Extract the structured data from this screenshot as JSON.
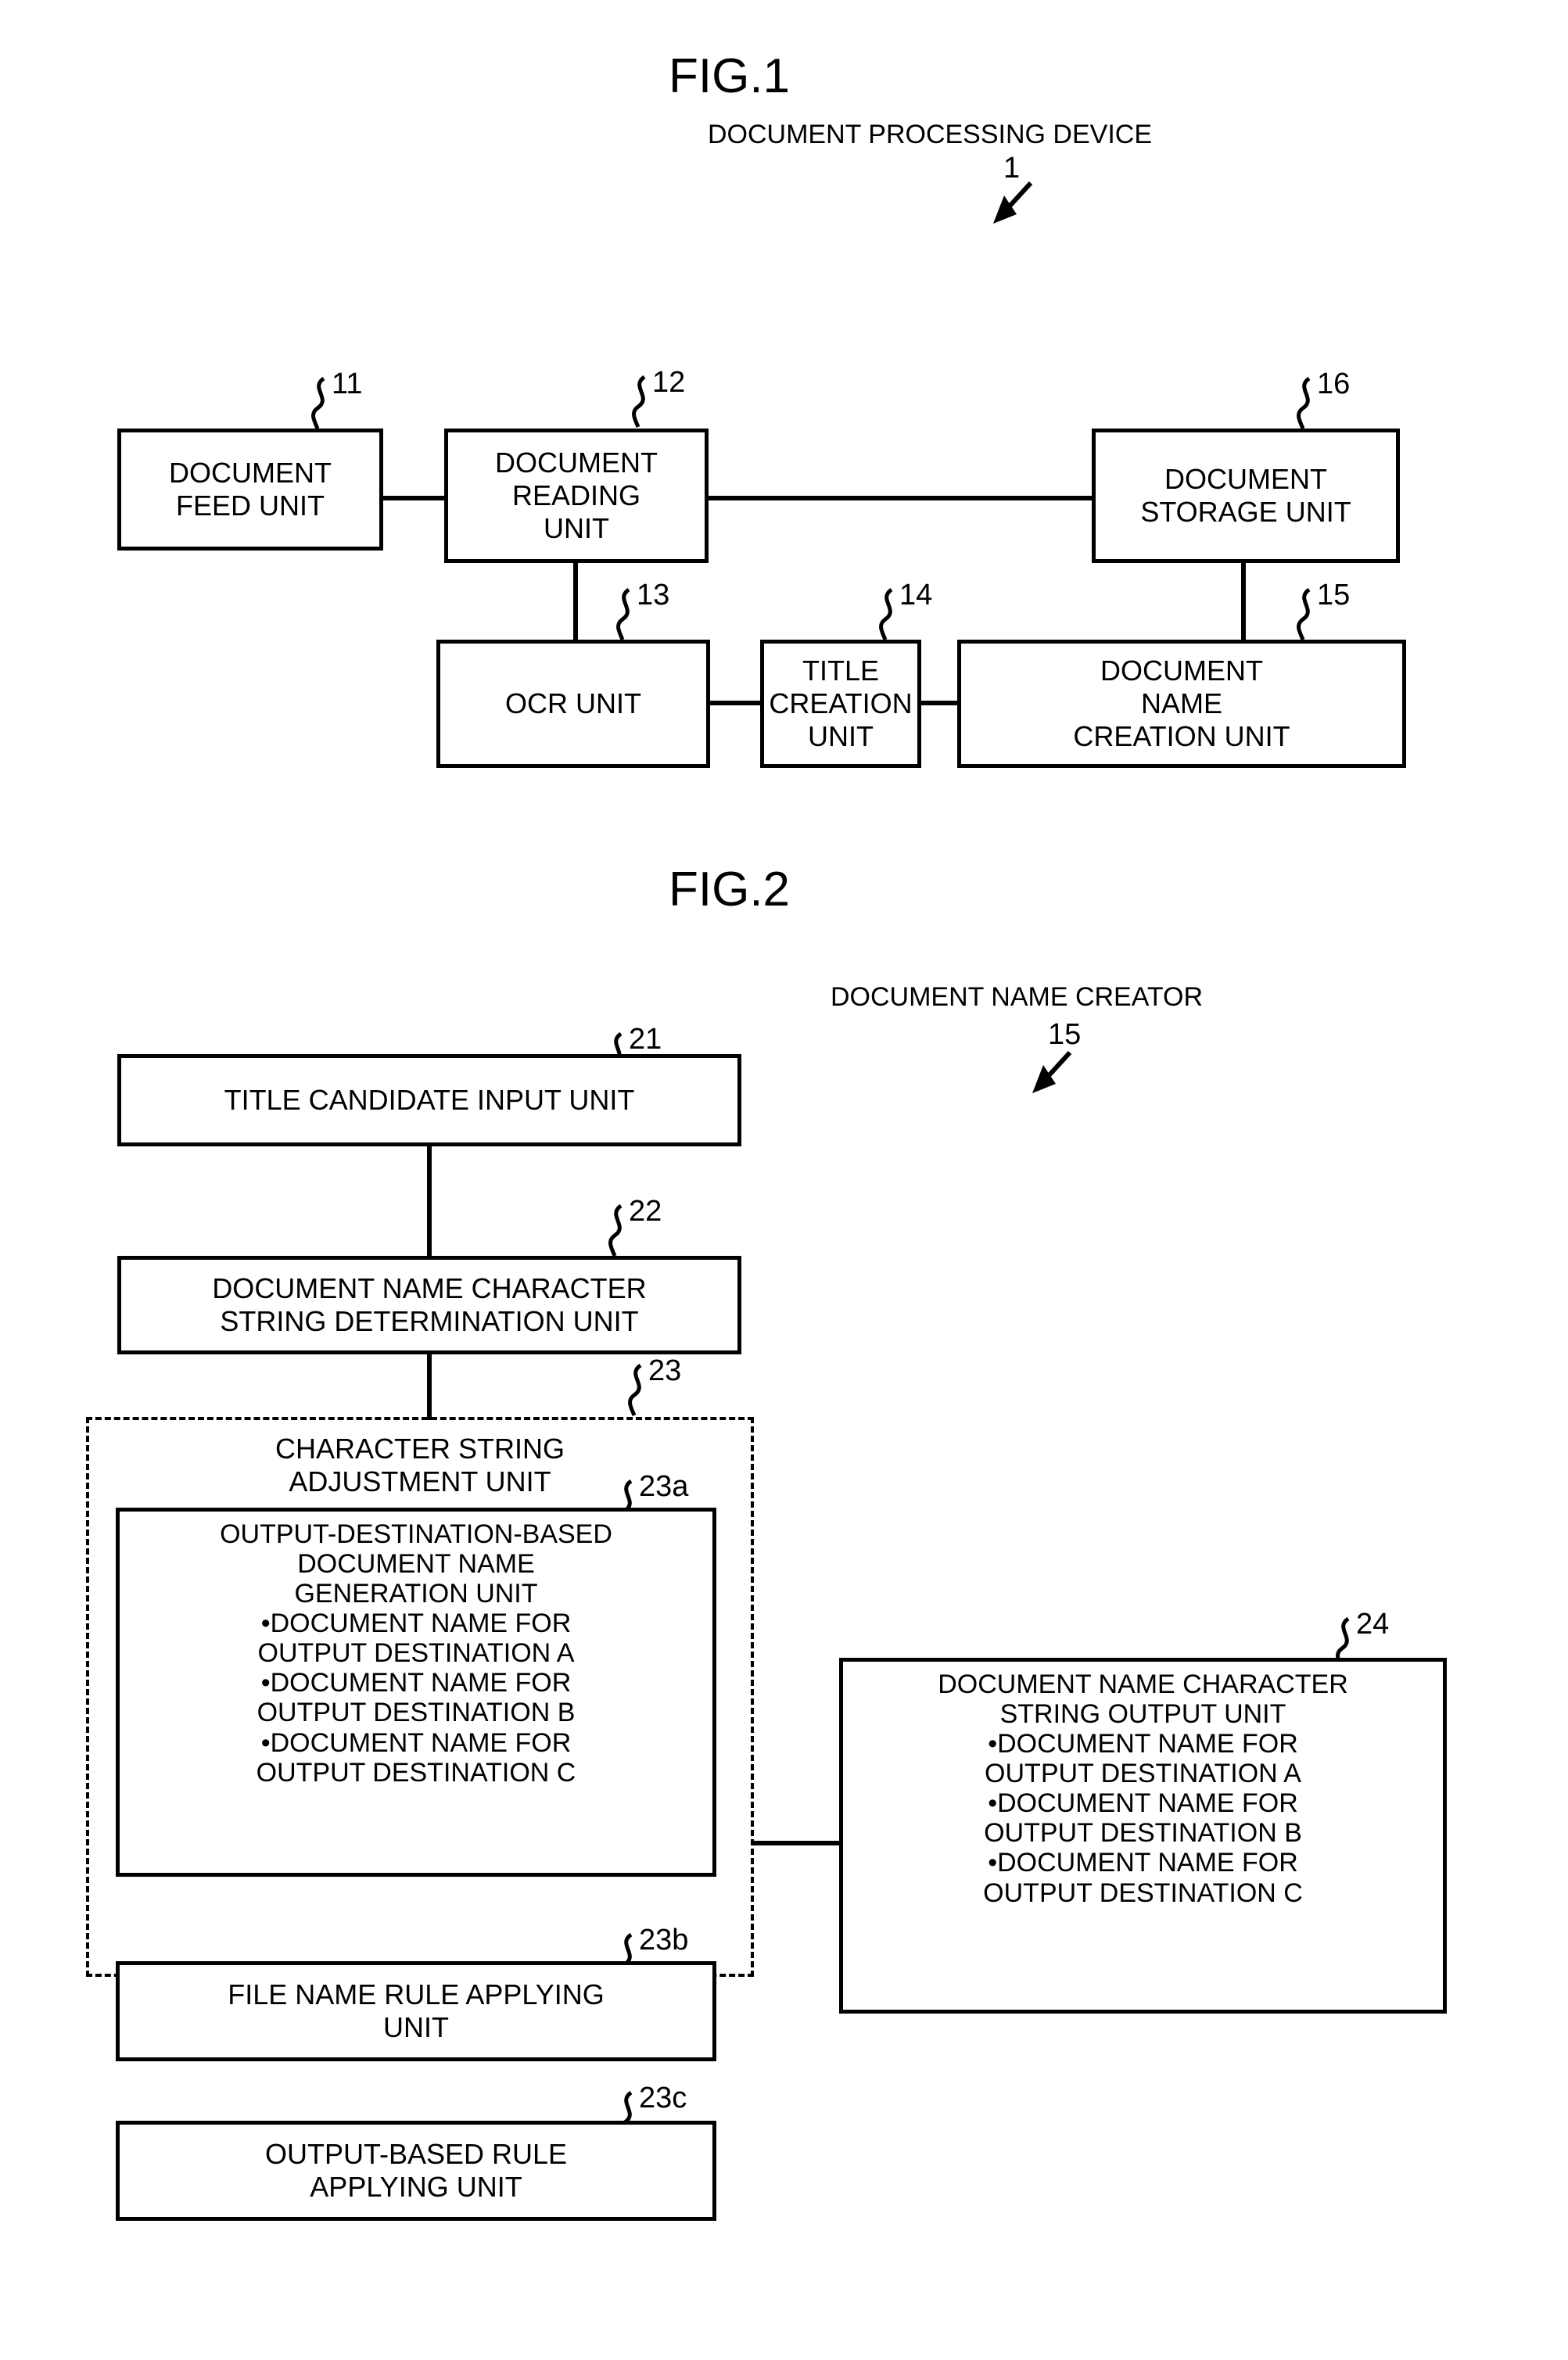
{
  "page": {
    "background": "#ffffff",
    "ink": "#000000"
  },
  "figures": [
    {
      "id": "fig1",
      "title": "FIG.1",
      "caption": "DOCUMENT PROCESSING DEVICE",
      "caption_ref": "1",
      "blocks": [
        {
          "ref": "11",
          "lines": [
            "DOCUMENT",
            "FEED UNIT"
          ]
        },
        {
          "ref": "12",
          "lines": [
            "DOCUMENT",
            "READING",
            "UNIT"
          ]
        },
        {
          "ref": "16",
          "lines": [
            "DOCUMENT",
            "STORAGE UNIT"
          ]
        },
        {
          "ref": "13",
          "lines": [
            "OCR UNIT"
          ]
        },
        {
          "ref": "14",
          "lines": [
            "TITLE",
            "CREATION",
            "UNIT"
          ]
        },
        {
          "ref": "15",
          "lines": [
            "DOCUMENT",
            "NAME",
            "CREATION UNIT"
          ]
        }
      ]
    },
    {
      "id": "fig2",
      "title": "FIG.2",
      "caption": "DOCUMENT NAME CREATOR",
      "caption_ref": "15",
      "blocks": [
        {
          "ref": "21",
          "lines": [
            "TITLE CANDIDATE INPUT UNIT"
          ]
        },
        {
          "ref": "22",
          "lines": [
            "DOCUMENT NAME CHARACTER",
            "STRING DETERMINATION UNIT"
          ]
        },
        {
          "ref": "23",
          "lines": [
            "CHARACTER STRING",
            "ADJUSTMENT UNIT"
          ],
          "style": "dashed-container"
        },
        {
          "ref": "23a",
          "lines": [
            "OUTPUT-DESTINATION-BASED",
            "DOCUMENT NAME",
            "GENERATION UNIT",
            "•DOCUMENT NAME FOR",
            "OUTPUT DESTINATION A",
            "•DOCUMENT NAME FOR",
            "OUTPUT DESTINATION B",
            "•DOCUMENT NAME FOR",
            "OUTPUT DESTINATION C"
          ]
        },
        {
          "ref": "23b",
          "lines": [
            "FILE NAME RULE APPLYING",
            "UNIT"
          ]
        },
        {
          "ref": "23c",
          "lines": [
            "OUTPUT-BASED RULE",
            "APPLYING UNIT"
          ]
        },
        {
          "ref": "24",
          "lines": [
            "DOCUMENT NAME CHARACTER",
            "STRING OUTPUT UNIT",
            "•DOCUMENT NAME FOR",
            "OUTPUT DESTINATION A",
            "•DOCUMENT NAME FOR",
            "OUTPUT DESTINATION B",
            "•DOCUMENT NAME FOR",
            "OUTPUT DESTINATION C"
          ]
        }
      ]
    }
  ],
  "fig1": {
    "title": "FIG.1",
    "caption": "DOCUMENT PROCESSING DEVICE",
    "caption_ref": "1",
    "b11": {
      "ref": "11",
      "l1": "DOCUMENT",
      "l2": "FEED UNIT"
    },
    "b12": {
      "ref": "12",
      "l1": "DOCUMENT",
      "l2": "READING",
      "l3": "UNIT"
    },
    "b16": {
      "ref": "16",
      "l1": "DOCUMENT",
      "l2": "STORAGE UNIT"
    },
    "b13": {
      "ref": "13",
      "l1": "OCR UNIT"
    },
    "b14": {
      "ref": "14",
      "l1": "TITLE",
      "l2": "CREATION",
      "l3": "UNIT"
    },
    "b15": {
      "ref": "15",
      "l1": "DOCUMENT",
      "l2": "NAME",
      "l3": "CREATION UNIT"
    }
  },
  "fig2": {
    "title": "FIG.2",
    "caption": "DOCUMENT NAME CREATOR",
    "caption_ref": "15",
    "b21": {
      "ref": "21",
      "l1": "TITLE CANDIDATE INPUT UNIT"
    },
    "b22": {
      "ref": "22",
      "l1": "DOCUMENT NAME CHARACTER",
      "l2": "STRING DETERMINATION UNIT"
    },
    "b23": {
      "ref": "23",
      "l1": "CHARACTER STRING",
      "l2": "ADJUSTMENT UNIT"
    },
    "b23a": {
      "ref": "23a",
      "l1": "OUTPUT-DESTINATION-BASED",
      "l2": "DOCUMENT NAME",
      "l3": "GENERATION UNIT",
      "l4": "•DOCUMENT NAME FOR",
      "l5": "OUTPUT DESTINATION A",
      "l6": "•DOCUMENT NAME FOR",
      "l7": "OUTPUT DESTINATION B",
      "l8": "•DOCUMENT NAME FOR",
      "l9": "OUTPUT DESTINATION C"
    },
    "b23b": {
      "ref": "23b",
      "l1": "FILE NAME RULE APPLYING",
      "l2": "UNIT"
    },
    "b23c": {
      "ref": "23c",
      "l1": "OUTPUT-BASED RULE",
      "l2": "APPLYING UNIT"
    },
    "b24": {
      "ref": "24",
      "l1": "DOCUMENT NAME CHARACTER",
      "l2": "STRING OUTPUT UNIT",
      "l3": "•DOCUMENT NAME FOR",
      "l4": "OUTPUT DESTINATION A",
      "l5": "•DOCUMENT NAME FOR",
      "l6": "OUTPUT DESTINATION B",
      "l7": "•DOCUMENT NAME FOR",
      "l8": "OUTPUT DESTINATION C"
    }
  }
}
